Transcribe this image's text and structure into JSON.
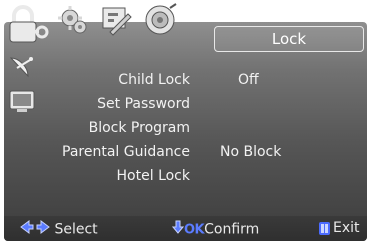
{
  "menu": {
    "title": "Lock",
    "items": [
      {
        "label": "Child Lock",
        "value": "Off"
      },
      {
        "label": "Set Password",
        "value": ""
      },
      {
        "label": "Block Program",
        "value": ""
      },
      {
        "label": "Parental Guidance",
        "value": "No Block"
      },
      {
        "label": "Hotel Lock",
        "value": ""
      }
    ]
  },
  "tabs": [
    {
      "icon": "lock-icon"
    },
    {
      "icon": "gear-icon"
    },
    {
      "icon": "tools-icon"
    },
    {
      "icon": "speaker-icon"
    }
  ],
  "sidebar": [
    {
      "icon": "satellite-dish-icon"
    },
    {
      "icon": "tv-icon"
    }
  ],
  "footer": {
    "select_label": "Select",
    "confirm_key": "OK",
    "confirm_label": "Confirm",
    "exit_label": "Exit"
  },
  "colors": {
    "panel_top": "#8f8f8f",
    "panel_bottom": "#3c3c3c",
    "text": "#f2f2f2",
    "accent_blue": "#4b6bff"
  }
}
